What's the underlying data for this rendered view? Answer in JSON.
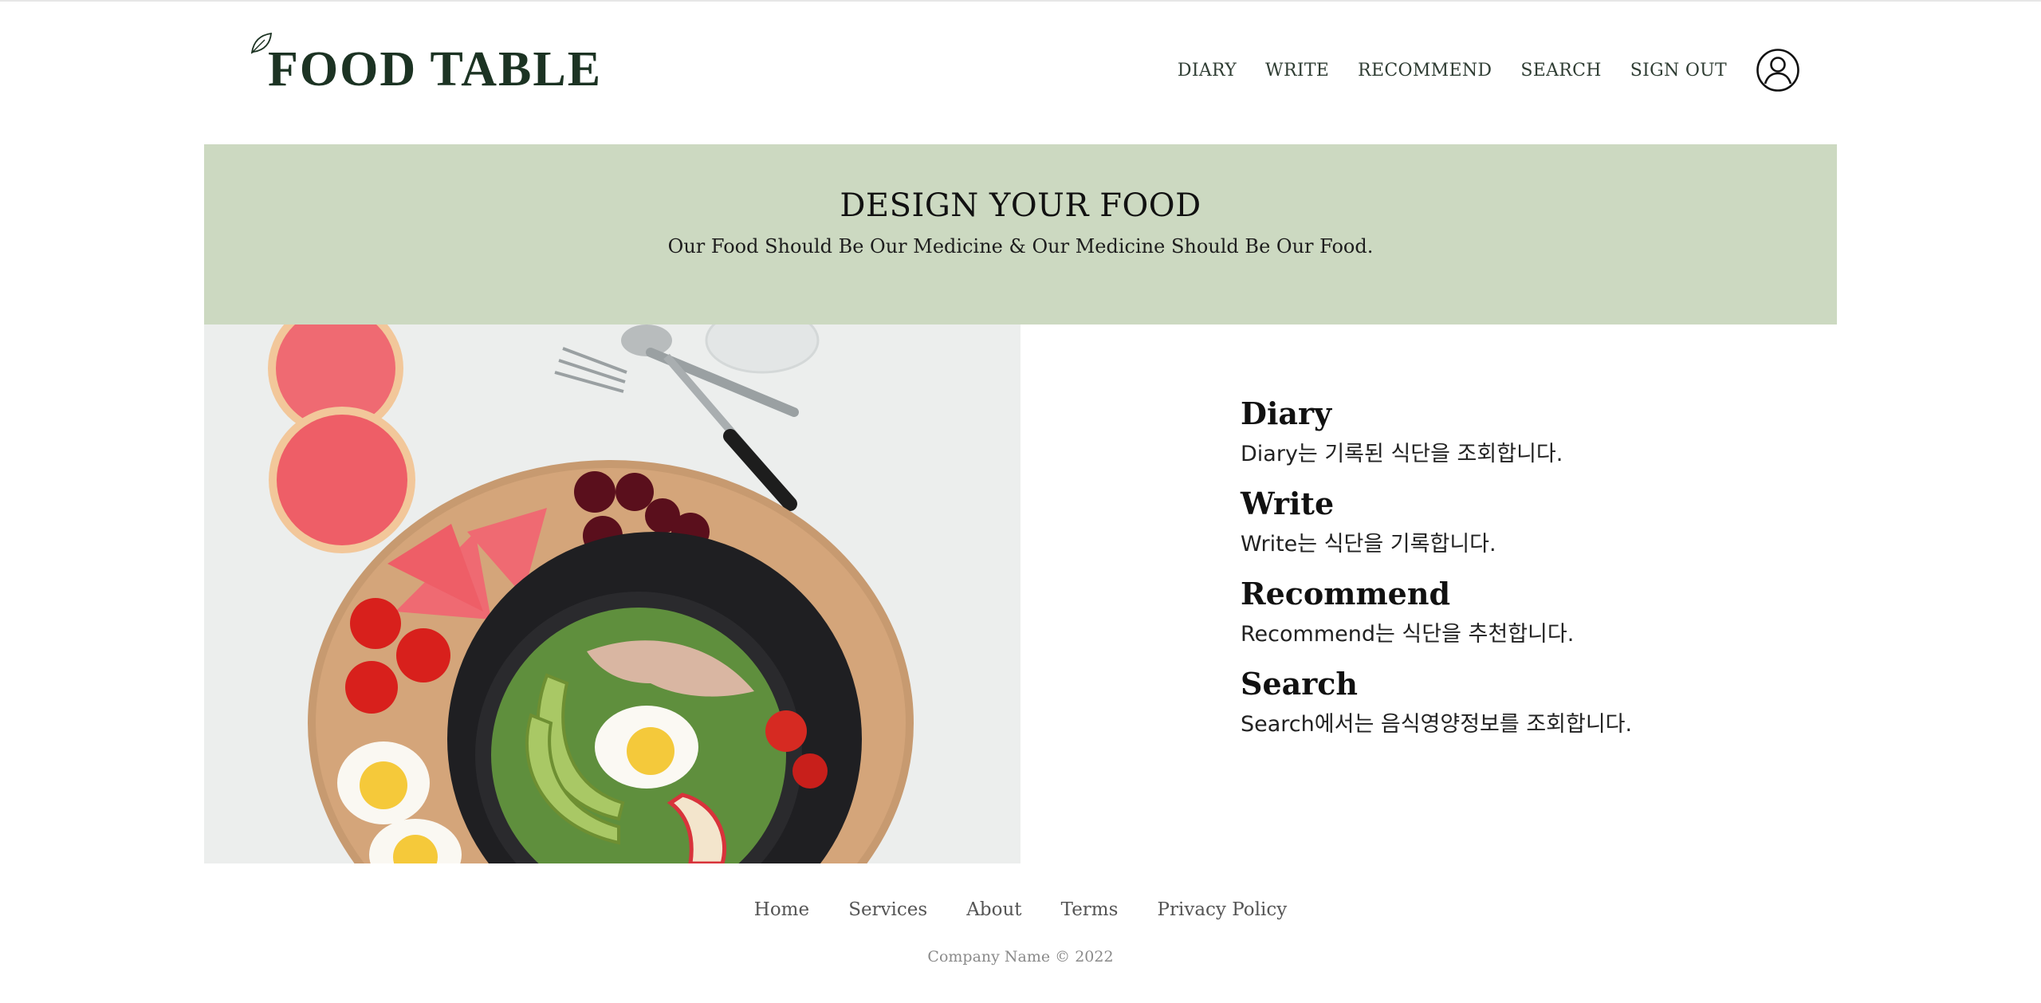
{
  "brand": {
    "name": "FOOD TABLE",
    "icon": "leaf-icon",
    "color": "#1c3323"
  },
  "nav": {
    "items": [
      "DIARY",
      "WRITE",
      "RECOMMEND",
      "SEARCH",
      "SIGN OUT"
    ],
    "profile_icon": "user-circle-icon"
  },
  "hero": {
    "title": "DESIGN YOUR FOOD",
    "subtitle": "Our Food Should Be Our Medicine & Our Medicine Should Be Our Food.",
    "background": "#ccd9c1"
  },
  "features": [
    {
      "title": "Diary",
      "desc": "Diary는 기록된 식단을 조회합니다."
    },
    {
      "title": "Write",
      "desc": "Write는 식단을 기록합니다."
    },
    {
      "title": "Recommend",
      "desc": "Recommend는 식단을 추천합니다."
    },
    {
      "title": "Search",
      "desc": "Search에서는 음식영양정보를 조회합니다."
    }
  ],
  "footer": {
    "links": [
      "Home",
      "Services",
      "About",
      "Terms",
      "Privacy Policy"
    ],
    "copyright": "Company Name © 2022"
  }
}
